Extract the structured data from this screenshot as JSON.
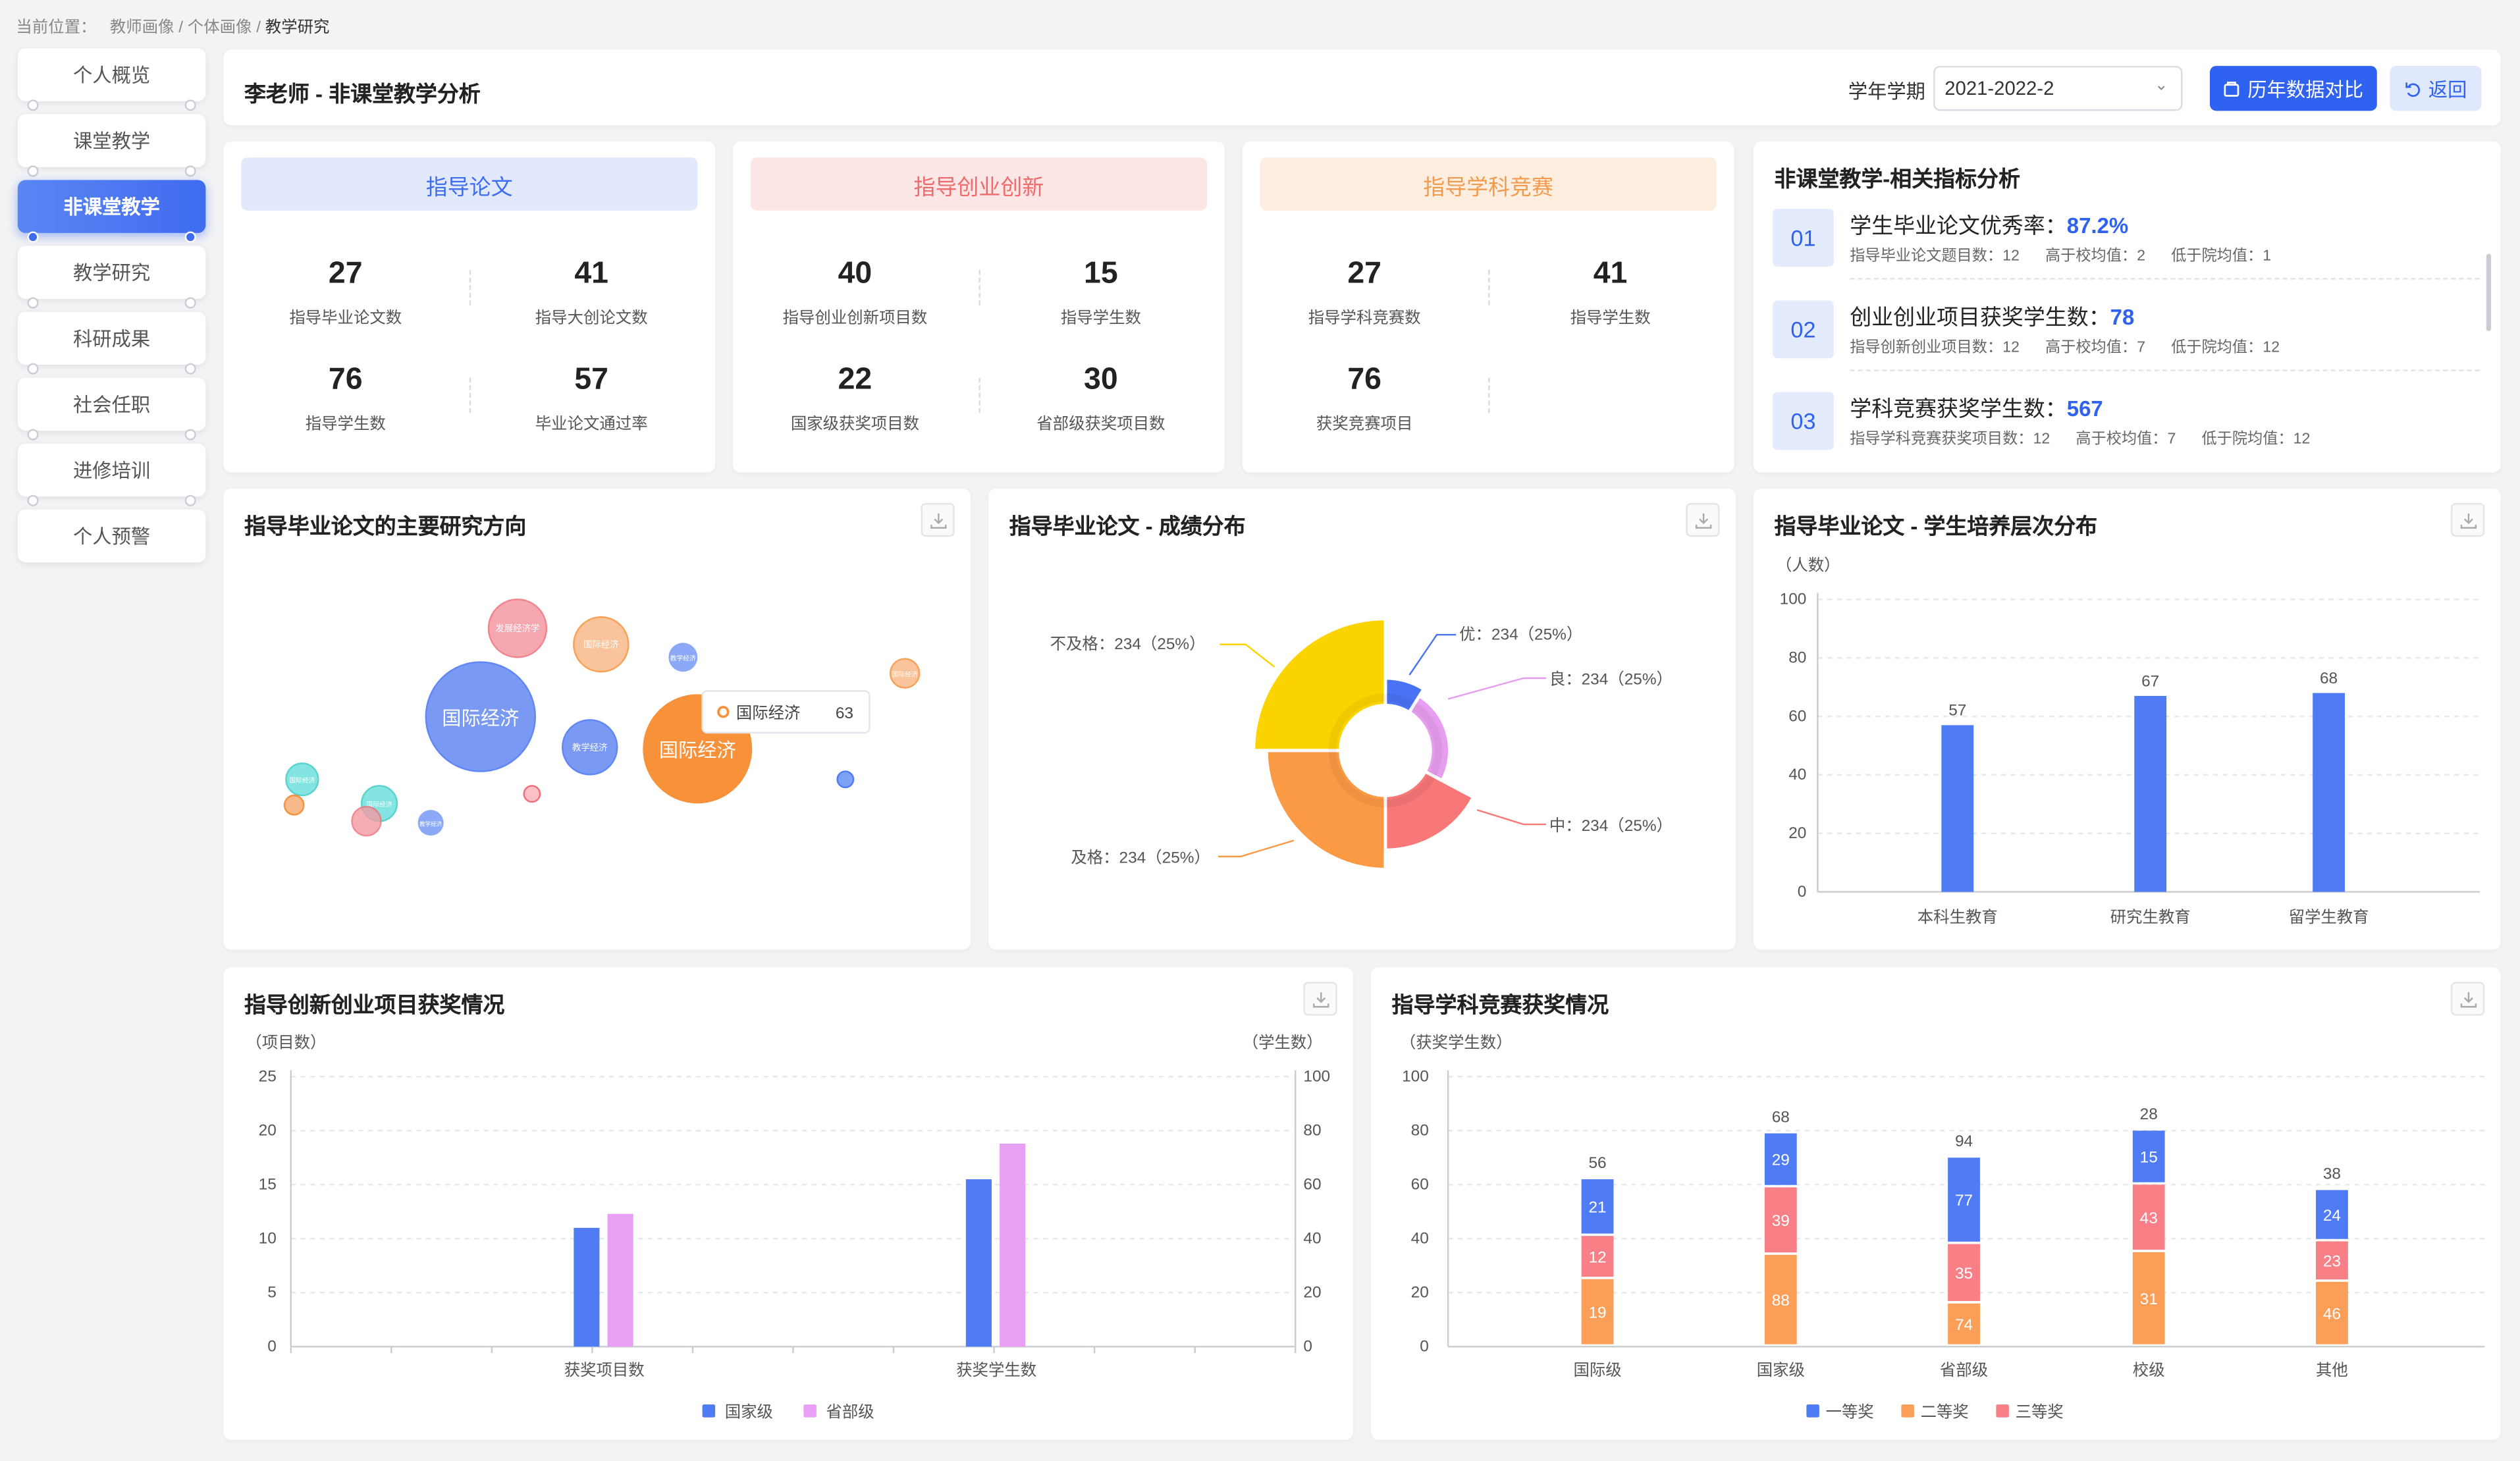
{
  "breadcrumb": {
    "prefix": "当前位置：",
    "path1": "教师画像",
    "sep": " / ",
    "path2": "个体画像",
    "current": "教学研究"
  },
  "sidebar": {
    "items": [
      {
        "label": "个人概览",
        "active": false
      },
      {
        "label": "课堂教学",
        "active": false
      },
      {
        "label": "非课堂教学",
        "active": true
      },
      {
        "label": "教学研究",
        "active": false
      },
      {
        "label": "科研成果",
        "active": false
      },
      {
        "label": "社会任职",
        "active": false
      },
      {
        "label": "进修培训",
        "active": false
      },
      {
        "label": "个人预警",
        "active": false
      }
    ]
  },
  "header": {
    "title": "李老师 - 非课堂教学分析",
    "term_label": "学年学期",
    "term_value": "2021-2022-2",
    "compare_btn": "历年数据对比",
    "back_btn": "返回"
  },
  "stats": [
    {
      "title": "指导论文",
      "bg": "#e2e9fc",
      "fg": "#3d6df0",
      "cells": [
        {
          "num": "27",
          "label": "指导毕业论文数"
        },
        {
          "num": "41",
          "label": "指导大创论文数"
        },
        {
          "num": "76",
          "label": "指导学生数"
        },
        {
          "num": "57",
          "label": "毕业论文通过率"
        }
      ]
    },
    {
      "title": "指导创业创新",
      "bg": "#fde6e6",
      "fg": "#ef6b6b",
      "cells": [
        {
          "num": "40",
          "label": "指导创业创新项目数"
        },
        {
          "num": "15",
          "label": "指导学生数"
        },
        {
          "num": "22",
          "label": "国家级获奖项目数"
        },
        {
          "num": "30",
          "label": "省部级获奖项目数"
        }
      ]
    },
    {
      "title": "指导学科竞赛",
      "bg": "#fdeedf",
      "fg": "#f39b4c",
      "cells": [
        {
          "num": "27",
          "label": "指导学科竞赛数"
        },
        {
          "num": "41",
          "label": "指导学生数"
        },
        {
          "num": "76",
          "label": "获奖竞赛项目"
        }
      ]
    }
  ],
  "metrics": {
    "title": "非课堂教学-相关指标分析",
    "items": [
      {
        "no": "01",
        "label": "学生毕业论文优秀率：",
        "value": "87.2%",
        "subs": [
          "指导毕业论文题目数：12",
          "高于校均值：2",
          "低于院均值：1"
        ]
      },
      {
        "no": "02",
        "label": "创业创业项目获奖学生数：",
        "value": "78",
        "subs": [
          "指导创新创业项目数：12",
          "高于校均值：7",
          "低于院均值：12"
        ]
      },
      {
        "no": "03",
        "label": "学科竞赛获奖学生数：",
        "value": "567",
        "subs": [
          "指导学科竞赛获奖项目数：12",
          "高于校均值：7",
          "低于院均值：12"
        ]
      }
    ]
  },
  "bubble_card": {
    "title": "指导毕业论文的主要研究方向",
    "tooltip": {
      "name": "国际经济",
      "value": "63"
    },
    "bubbles": [
      {
        "label": "国际经济",
        "color": "#6b8ef2",
        "size": "l"
      },
      {
        "label": "国际经济",
        "color": "#f7913a",
        "size": "l"
      },
      {
        "label": "发展经济学",
        "color": "#f49aa3",
        "size": "m"
      },
      {
        "label": "国际经济",
        "color": "#f9b98a",
        "size": "m"
      },
      {
        "label": "教学经济",
        "color": "#6b8ef2",
        "size": "m"
      },
      {
        "label": "教学经济",
        "color": "#7ea0f5",
        "size": "s"
      },
      {
        "label": "国际经济",
        "color": "#f9b98a",
        "size": "s"
      },
      {
        "label": "国际经济",
        "color": "#6ee0dc",
        "size": "s"
      },
      {
        "label": "国际经济",
        "color": "#6ee0dc",
        "size": "s"
      },
      {
        "label": "教学经济",
        "color": "#7ea0f5",
        "size": "s"
      }
    ]
  },
  "pie_card": {
    "title": "指导毕业论文 - 成绩分布"
  },
  "level_card": {
    "title": "指导毕业论文 - 学生培养层次分布"
  },
  "innov_card": {
    "title": "指导创新创业项目获奖情况"
  },
  "comp_card": {
    "title": "指导学科竞赛获奖情况"
  },
  "chart_data": [
    {
      "type": "pie",
      "title": "指导毕业论文 - 成绩分布",
      "slices": [
        {
          "name": "优",
          "value": 234,
          "pct": "25%",
          "color": "#4a72f5",
          "label": "优：234（25%）"
        },
        {
          "name": "良",
          "value": 234,
          "pct": "25%",
          "color": "#e89ef0",
          "label": "良：234（25%）"
        },
        {
          "name": "中",
          "value": 234,
          "pct": "25%",
          "color": "#f87878",
          "label": "中：234（25%）"
        },
        {
          "name": "及格",
          "value": 234,
          "pct": "25%",
          "color": "#fb9a45",
          "label": "及格：234（25%）"
        },
        {
          "name": "不及格",
          "value": 234,
          "pct": "25%",
          "color": "#fbd400",
          "label": "不及格：234（25%）"
        }
      ]
    },
    {
      "type": "bar",
      "title": "指导毕业论文 - 学生培养层次分布",
      "ylabel": "（人数）",
      "categories": [
        "本科生教育",
        "研究生教育",
        "留学生教育"
      ],
      "values": [
        57,
        67,
        68
      ],
      "ylim": [
        0,
        100
      ],
      "yticks": [
        0,
        20,
        40,
        60,
        80,
        100
      ],
      "color": "#4f7bf4"
    },
    {
      "type": "bar",
      "title": "指导创新创业项目获奖情况",
      "ylabel_left": "（项目数）",
      "ylabel_right": "（学生数）",
      "categories": [
        "获奖项目数",
        "获奖学生数"
      ],
      "series": [
        {
          "name": "国家级",
          "color": "#4f7bf4",
          "values": [
            11,
            15.5
          ]
        },
        {
          "name": "省部级",
          "color": "#e8a0f4",
          "values": [
            12.3,
            18.8
          ]
        }
      ],
      "ylim_left": [
        0,
        25
      ],
      "yticks_left": [
        0,
        5,
        10,
        15,
        20,
        25
      ],
      "ylim_right": [
        0,
        100
      ],
      "yticks_right": [
        0,
        20,
        40,
        60,
        80,
        100
      ]
    },
    {
      "type": "bar",
      "title": "指导学科竞赛获奖情况",
      "ylabel": "（获奖学生数）",
      "stacked": true,
      "categories": [
        "国际级",
        "国家级",
        "省部级",
        "校级",
        "其他"
      ],
      "totals": [
        "56",
        "68",
        "94",
        "28",
        "38"
      ],
      "series": [
        {
          "name": "一等奖",
          "color": "#4f7bf4",
          "values": [
            21,
            29,
            77,
            15,
            24
          ],
          "heights": [
            21,
            20,
            32,
            20,
            19
          ]
        },
        {
          "name": "三等奖",
          "color": "#f87f86",
          "values": [
            12,
            39,
            35,
            43,
            23
          ],
          "heights": [
            16,
            25,
            22,
            25,
            15
          ]
        },
        {
          "name": "二等奖",
          "color": "#fb9e58",
          "values": [
            19,
            88,
            74,
            31,
            46
          ],
          "heights": [
            25,
            34,
            16,
            35,
            24
          ]
        }
      ],
      "legend": [
        {
          "name": "一等奖",
          "color": "#4f7bf4"
        },
        {
          "name": "二等奖",
          "color": "#fb9e58"
        },
        {
          "name": "三等奖",
          "color": "#f87f86"
        }
      ],
      "ylim": [
        0,
        100
      ],
      "yticks": [
        0,
        20,
        40,
        60,
        80,
        100
      ]
    }
  ]
}
